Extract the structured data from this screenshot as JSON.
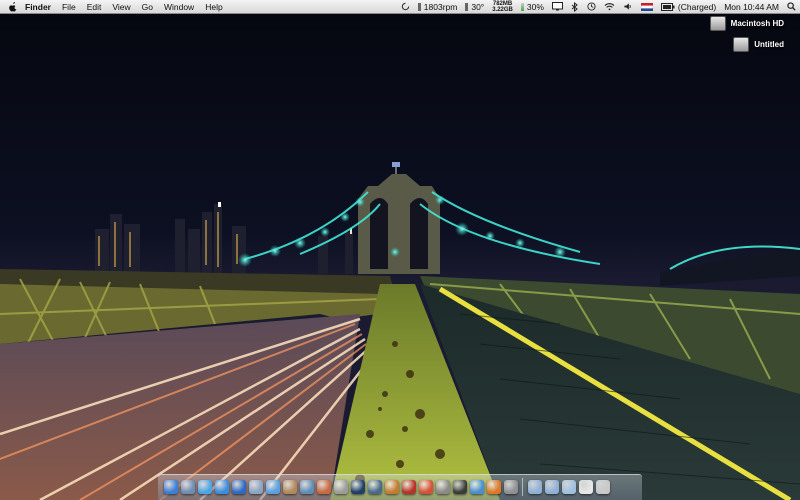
{
  "menubar": {
    "app_name": "Finder",
    "items": [
      "File",
      "Edit",
      "View",
      "Go",
      "Window",
      "Help"
    ]
  },
  "status": {
    "fan": "1803rpm",
    "temperature": "30°",
    "mem_top": "782MB",
    "mem_bottom": "3.22GB",
    "cpu": "30%",
    "battery_state": "(Charged)",
    "clock": "Mon 10:44 AM"
  },
  "desktop": {
    "icons": [
      {
        "label": "Macintosh HD",
        "icon": "hard-drive-icon"
      },
      {
        "label": "Untitled",
        "icon": "hard-drive-icon"
      }
    ]
  },
  "dock": {
    "items": [
      {
        "icon": "finder-icon",
        "color": "#3a7fd8"
      },
      {
        "icon": "preview-icon",
        "color": "#6d8db5"
      },
      {
        "icon": "ichat-icon",
        "color": "#4aa6e8"
      },
      {
        "icon": "safari-icon",
        "color": "#3b8ee0"
      },
      {
        "icon": "globe-icon",
        "color": "#2c6bc4"
      },
      {
        "icon": "mail-icon",
        "color": "#8aa4c2"
      },
      {
        "icon": "itunes-icon",
        "color": "#5aa0e0"
      },
      {
        "icon": "address-book-icon",
        "color": "#b08a5a"
      },
      {
        "icon": "iphoto-icon",
        "color": "#5e8fb8"
      },
      {
        "icon": "utilities-icon",
        "color": "#c86a3c"
      },
      {
        "icon": "flag-icon",
        "color": "#9c9c9c"
      },
      {
        "icon": "photoshop-icon",
        "color": "#1d3d6b"
      },
      {
        "icon": "network-icon",
        "color": "#4a6a8a"
      },
      {
        "icon": "brush-icon",
        "color": "#c47a32"
      },
      {
        "icon": "book-icon",
        "color": "#b8322a"
      },
      {
        "icon": "pinwheel-icon",
        "color": "#d8503a"
      },
      {
        "icon": "system-preferences-icon",
        "color": "#8a8a8a"
      },
      {
        "icon": "dashboard-icon",
        "color": "#3a3a3a"
      },
      {
        "icon": "movie-icon",
        "color": "#4a90d0"
      },
      {
        "icon": "firefox-icon",
        "color": "#e07828"
      },
      {
        "icon": "spotlight-icon",
        "color": "#909090"
      },
      {
        "icon": "applications-folder-icon",
        "color": "#8fb0d6"
      },
      {
        "icon": "documents-folder-icon",
        "color": "#8fb0d6"
      },
      {
        "icon": "downloads-folder-icon",
        "color": "#9fc0e0"
      },
      {
        "icon": "document-icon",
        "color": "#e6e6e6"
      },
      {
        "icon": "trash-icon",
        "color": "#c8c8c8"
      }
    ]
  }
}
